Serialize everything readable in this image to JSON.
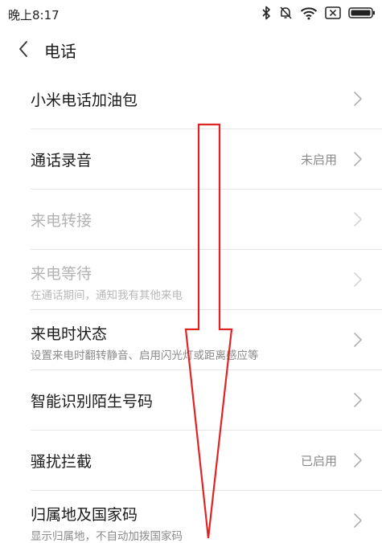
{
  "status_bar": {
    "time": "晚上8:17",
    "icons": [
      "bluetooth-icon",
      "mute-bell-icon",
      "wifi-icon",
      "close-box-icon",
      "battery-icon"
    ]
  },
  "header": {
    "back_icon": "chevron-left-icon",
    "title": "电话"
  },
  "settings": [
    {
      "title": "小米电话加油包",
      "subtitle": "",
      "value": "",
      "disabled": false
    },
    {
      "title": "通话录音",
      "subtitle": "",
      "value": "未启用",
      "disabled": false
    },
    {
      "title": "来电转接",
      "subtitle": "",
      "value": "",
      "disabled": true
    },
    {
      "title": "来电等待",
      "subtitle": "在通话期间，通知我有其他来电",
      "value": "",
      "disabled": true
    },
    {
      "title": "来电时状态",
      "subtitle": "设置来电时翻转静音、启用闪光灯或距离感应等",
      "value": "",
      "disabled": false
    },
    {
      "title": "智能识别陌生号码",
      "subtitle": "",
      "value": "",
      "disabled": false
    },
    {
      "title": "骚扰拦截",
      "subtitle": "",
      "value": "已启用",
      "disabled": false
    },
    {
      "title": "归属地及国家码",
      "subtitle": "显示归属地，不自动加拨国家码",
      "value": "",
      "disabled": false
    }
  ],
  "colors": {
    "annotation_arrow": "#e02424",
    "chevron": "#b0b0b0",
    "divider": "#e6e6e6"
  }
}
